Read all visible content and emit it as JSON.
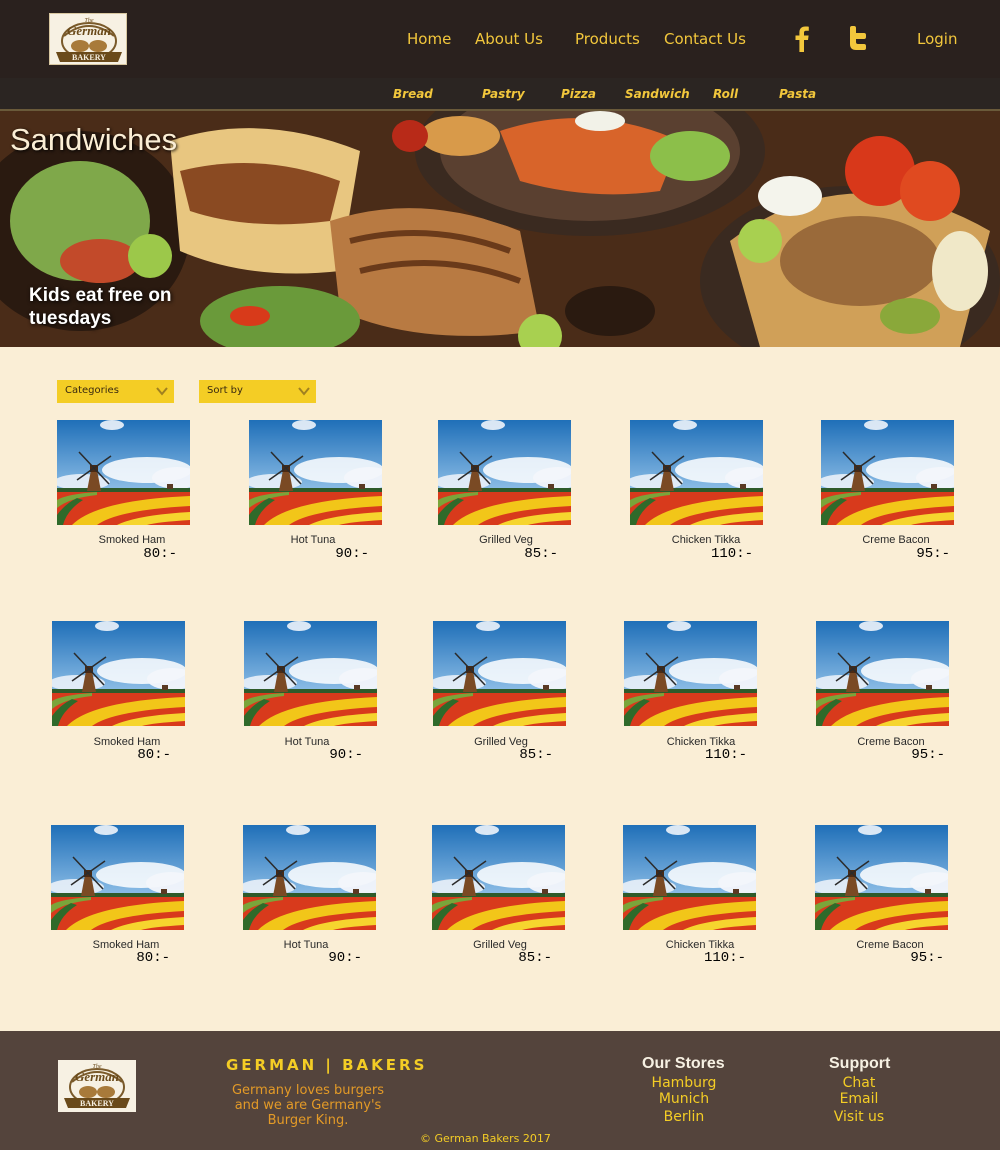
{
  "brand": {
    "logo_line1": "The",
    "logo_line2": "German",
    "logo_line3": "BAKERY"
  },
  "nav": {
    "home": "Home",
    "about": "About Us",
    "products": "Products",
    "contact": "Contact Us",
    "login": "Login"
  },
  "social": {
    "facebook_icon": "facebook-icon",
    "twitter_icon": "twitter-icon"
  },
  "categories": [
    "Bread",
    "Pastry",
    "Pizza",
    "Sandwich",
    "Roll",
    "Pasta"
  ],
  "hero": {
    "title": "Sandwiches",
    "promo": "Kids eat free on tuesdays"
  },
  "filters": {
    "categories": "Categories",
    "sort": "Sort by"
  },
  "products": [
    {
      "name": "Smoked Ham",
      "price": "80:-"
    },
    {
      "name": "Hot Tuna",
      "price": "90:-"
    },
    {
      "name": "Grilled Veg",
      "price": "85:-"
    },
    {
      "name": "Chicken Tikka",
      "price": "110:-"
    },
    {
      "name": "Creme Bacon",
      "price": "95:-"
    },
    {
      "name": "Smoked Ham",
      "price": "80:-"
    },
    {
      "name": "Hot Tuna",
      "price": "90:-"
    },
    {
      "name": "Grilled Veg",
      "price": "85:-"
    },
    {
      "name": "Chicken Tikka",
      "price": "110:-"
    },
    {
      "name": "Creme Bacon",
      "price": "95:-"
    },
    {
      "name": "Smoked Ham",
      "price": "80:-"
    },
    {
      "name": "Hot Tuna",
      "price": "90:-"
    },
    {
      "name": "Grilled Veg",
      "price": "85:-"
    },
    {
      "name": "Chicken Tikka",
      "price": "110:-"
    },
    {
      "name": "Creme Bacon",
      "price": "95:-"
    }
  ],
  "footer": {
    "brand": "GERMAN | BAKERS",
    "tagline": "Germany loves burgers and we are Germany's Burger King.",
    "stores_heading": "Our Stores",
    "stores": [
      "Hamburg",
      "Munich",
      "Berlin"
    ],
    "support_heading": "Support",
    "support": [
      "Chat",
      "Email",
      "Visit us"
    ],
    "copyright": "© German Bakers  2017"
  },
  "colors": {
    "header_bg": "#2a211e",
    "accent": "#f2c73c",
    "page_bg": "#faeed6",
    "footer_bg": "#54443c",
    "dropdown": "#f4cd25"
  }
}
